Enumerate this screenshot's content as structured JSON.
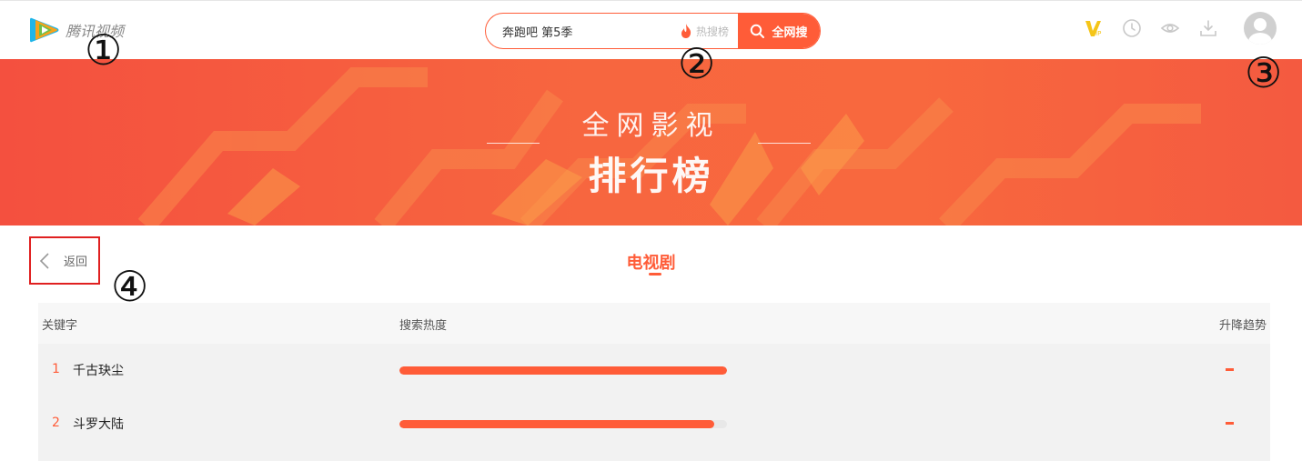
{
  "header": {
    "logo_text": "腾讯视频",
    "search": {
      "value": "奔跑吧 第5季",
      "hot_label": "热搜榜",
      "button_label": "全网搜"
    },
    "icons": [
      "vip-icon",
      "history-icon",
      "watch-icon",
      "download-icon",
      "user-avatar"
    ]
  },
  "markers": [
    "①",
    "②",
    "③",
    "④"
  ],
  "banner": {
    "line1": "全网影视",
    "line2": "排行榜"
  },
  "page": {
    "back_label": "返回",
    "category": "电视剧"
  },
  "table": {
    "columns": {
      "keyword": "关键字",
      "heat": "搜索热度",
      "trend": "升降趋势"
    },
    "rows": [
      {
        "rank": "1",
        "title": "千古玦尘",
        "heat": 1.0,
        "trend": "flat"
      },
      {
        "rank": "2",
        "title": "斗罗大陆",
        "heat": 0.96,
        "trend": "flat"
      }
    ]
  },
  "colors": {
    "accent": "#ff5c38",
    "banner": "#f7663f",
    "highlight_box": "#e02020"
  }
}
